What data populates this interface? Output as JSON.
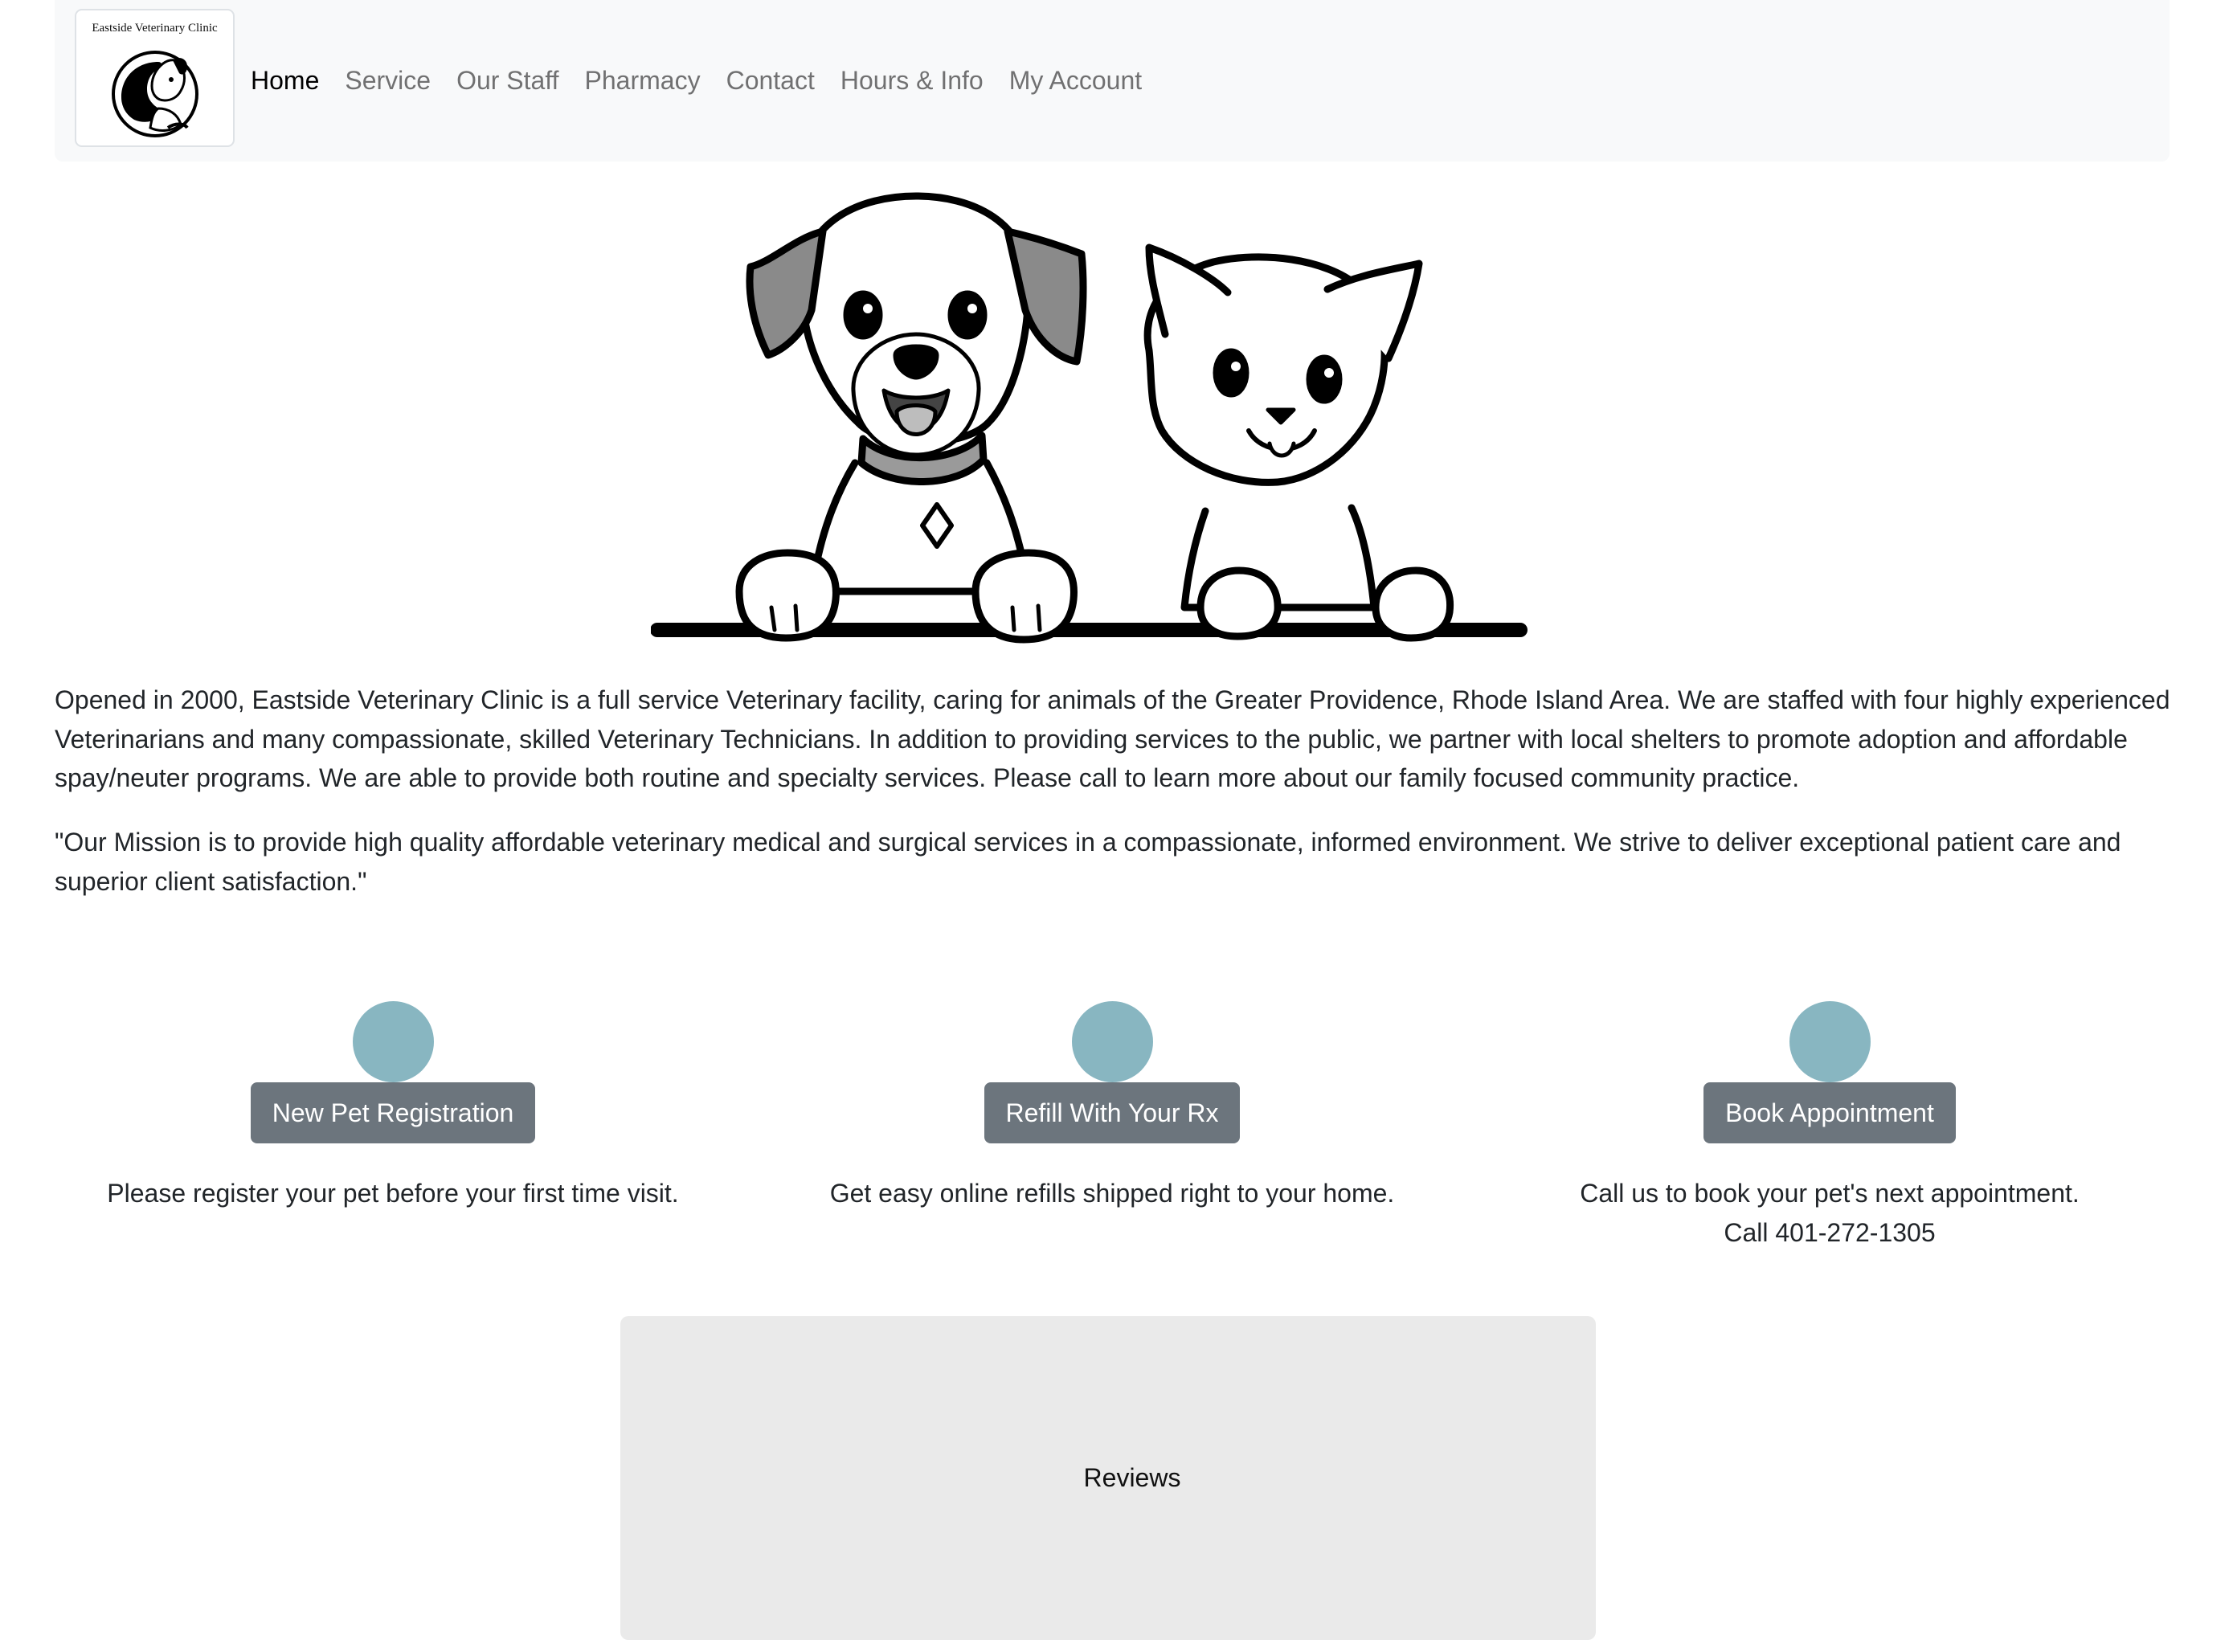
{
  "brand": {
    "logo_text": "Eastside Veterinary Clinic"
  },
  "nav": {
    "items": [
      {
        "label": "Home",
        "active": true
      },
      {
        "label": "Service",
        "active": false
      },
      {
        "label": "Our Staff",
        "active": false
      },
      {
        "label": "Pharmacy",
        "active": false
      },
      {
        "label": "Contact",
        "active": false
      },
      {
        "label": "Hours & Info",
        "active": false
      },
      {
        "label": "My Account",
        "active": false
      }
    ]
  },
  "hero": {
    "illustration": "dog-and-cat-peeking-illustration"
  },
  "intro": {
    "text": "Opened in 2000, Eastside Veterinary Clinic is a full service Veterinary facility, caring for animals of the Greater Providence, Rhode Island Area. We are staffed with four highly experienced Veterinarians and many compassionate, skilled Veterinary Technicians. In addition to providing services to the public, we partner with local shelters to promote adoption and affordable spay/neuter programs. We are able to provide both routine and specialty services. Please call to learn more about our family focused community practice."
  },
  "mission": {
    "text": "\"Our Mission is to provide high quality affordable veterinary medical and surgical services in a compassionate, informed environment. We strive to deliver exceptional patient care and superior client satisfaction.\""
  },
  "features": [
    {
      "button": "New Pet Registration",
      "text": "Please register your pet before your first time visit.",
      "text2": ""
    },
    {
      "button": "Refill With Your Rx",
      "text": "Get easy online refills shipped right to your home.",
      "text2": ""
    },
    {
      "button": "Book Appointment",
      "text": "Call us to book your pet's next appointment.",
      "text2": "Call 401-272-1305"
    }
  ],
  "colors": {
    "navbar_bg": "#f8f9fa",
    "accent_circle": "#88b6c1",
    "button_bg": "#6c757d",
    "reviews_bg": "#eaeaea"
  },
  "reviews": {
    "label": "Reviews"
  }
}
